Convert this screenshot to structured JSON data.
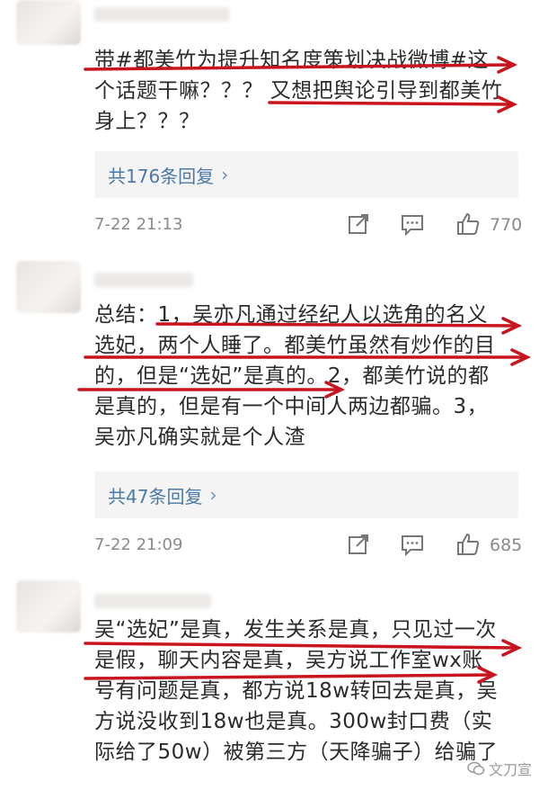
{
  "comments": [
    {
      "lines": [
        "带#都美竹为提升知名度策划决战微博#这",
        "个话题干嘛？？？ 又想把舆论引导到都美竹",
        "身上？？？"
      ],
      "replies_label": "共176条回复",
      "replies_chevron": "›",
      "date": "7-22 21:13",
      "likes": "770"
    },
    {
      "lines": [
        "总结：1，吴亦凡通过经纪人以选角的名义",
        "选妃，两个人睡了。都美竹虽然有炒作的目",
        "的，但是“选妃”是真的。2，都美竹说的都",
        "是真的，但是有一个中间人两边都骗。3，",
        "吴亦凡确实就是个人渣"
      ],
      "replies_label": "共47条回复",
      "replies_chevron": "›",
      "date": "7-22 21:09",
      "likes": "685"
    },
    {
      "lines": [
        "吴“选妃”是真，发生关系是真，只见过一次",
        "是假，聊天内容是真，吴方说工作室wx账",
        "号有问题是真，都方说18w转回去是真，吴",
        "方说没收到18w也是真。300w封口费（实",
        "际给了50w）被第三方（天降骗子）给骗了"
      ]
    }
  ],
  "watermark": "文刀宣",
  "icons": [
    "share-icon",
    "comment-icon",
    "like-icon"
  ],
  "accent_color": "#c8141e"
}
